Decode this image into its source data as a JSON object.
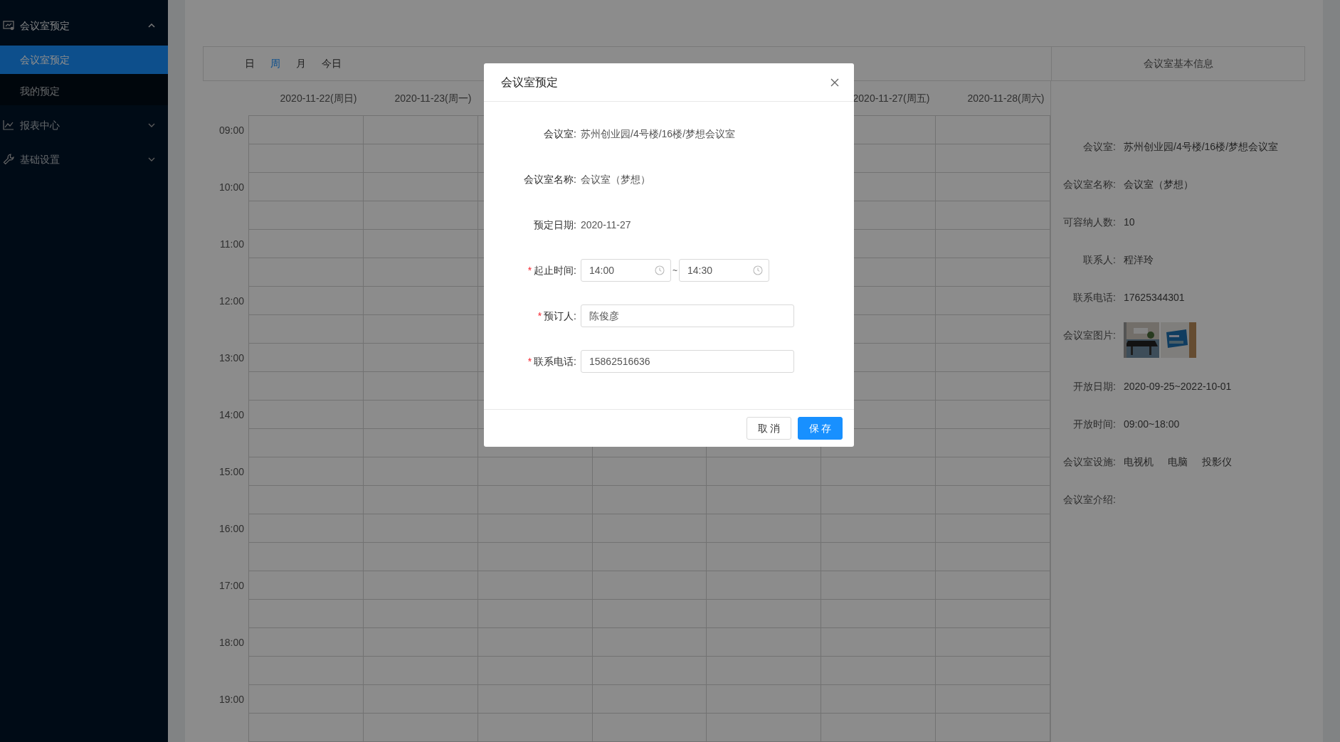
{
  "sidebar": {
    "groups": [
      {
        "label": "会议室预定",
        "expanded": true,
        "items": [
          {
            "label": "会议室预定",
            "selected": true
          },
          {
            "label": "我的预定",
            "selected": false
          }
        ]
      },
      {
        "label": "报表中心",
        "expanded": false
      },
      {
        "label": "基础设置",
        "expanded": false
      }
    ]
  },
  "toolbar": {
    "views": [
      {
        "label": "日",
        "selected": false
      },
      {
        "label": "周",
        "selected": true
      },
      {
        "label": "月",
        "selected": false
      },
      {
        "label": "今日",
        "selected": false
      }
    ],
    "info_title": "会议室基本信息"
  },
  "calendar": {
    "days": [
      {
        "label": "2020-11-22(周日)"
      },
      {
        "label": "2020-11-23(周一)"
      },
      {
        "label": "2020-11-27(周五)"
      },
      {
        "label": "2020-11-28(周六)"
      }
    ],
    "times": [
      "09:00",
      "10:00",
      "11:00",
      "12:00",
      "13:00",
      "14:00",
      "15:00",
      "16:00",
      "17:00",
      "18:00",
      "19:00"
    ]
  },
  "room_info": [
    {
      "kind": "text",
      "label": "会议室:",
      "value": "苏州创业园/4号楼/16楼/梦想会议室"
    },
    {
      "kind": "text",
      "label": "会议室名称:",
      "value": "会议室（梦想）"
    },
    {
      "kind": "text",
      "label": "可容纳人数:",
      "value": "10"
    },
    {
      "kind": "text",
      "label": "联系人:",
      "value": "程洋玲"
    },
    {
      "kind": "text",
      "label": "联系电话:",
      "value": "17625344301"
    },
    {
      "kind": "pictures",
      "label": "会议室图片:"
    },
    {
      "kind": "text",
      "label": "开放日期:",
      "value": "2020-09-25~2022-10-01"
    },
    {
      "kind": "text",
      "label": "开放时间:",
      "value": "09:00~18:00"
    },
    {
      "kind": "tags",
      "label": "会议室设施:",
      "tags": [
        "电视机",
        "电脑",
        "投影仪"
      ]
    },
    {
      "kind": "text",
      "label": "会议室介绍:"
    }
  ],
  "dialog": {
    "title": "会议室预定",
    "fields": [
      {
        "kind": "text",
        "label": "会议室:",
        "value": "苏州创业园/4号楼/16楼/梦想会议室"
      },
      {
        "kind": "text",
        "label": "会议室名称:",
        "value": "会议室（梦想）"
      },
      {
        "kind": "text",
        "label": "预定日期:",
        "value": "2020-11-27"
      },
      {
        "kind": "time_range",
        "label": "起止时间:",
        "required_mark": "*",
        "start": "14:00",
        "separator": "~",
        "end": "14:30"
      },
      {
        "kind": "input",
        "label": "预订人:",
        "required_mark": "*",
        "value": "陈俊彦"
      },
      {
        "kind": "input",
        "label": "联系电话:",
        "required_mark": "*",
        "value": "15862516636"
      }
    ],
    "buttons": [
      {
        "label": "取 消",
        "kind": "default"
      },
      {
        "label": "保 存",
        "kind": "primary"
      }
    ]
  }
}
